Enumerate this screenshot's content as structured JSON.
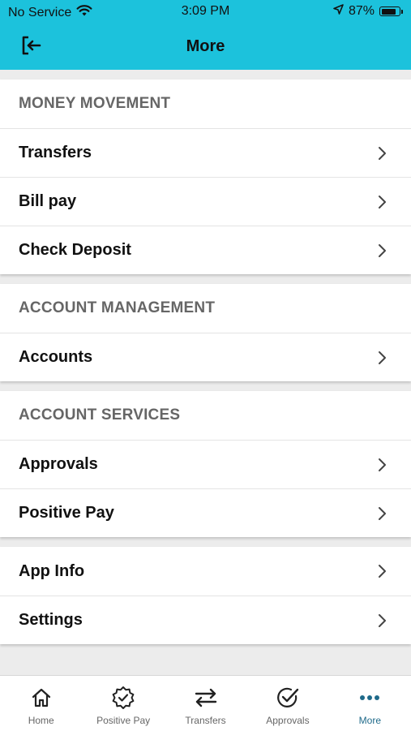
{
  "status_bar": {
    "carrier": "No Service",
    "time": "3:09 PM",
    "battery": "87%",
    "battery_level": 0.87
  },
  "header": {
    "title": "More",
    "logout_icon": "logout-icon"
  },
  "sections": [
    {
      "title": "MONEY MOVEMENT",
      "items": [
        {
          "label": "Transfers"
        },
        {
          "label": "Bill pay"
        },
        {
          "label": "Check Deposit"
        }
      ]
    },
    {
      "title": "ACCOUNT MANAGEMENT",
      "items": [
        {
          "label": "Accounts"
        }
      ]
    },
    {
      "title": "ACCOUNT SERVICES",
      "items": [
        {
          "label": "Approvals"
        },
        {
          "label": "Positive Pay"
        }
      ]
    },
    {
      "title": "",
      "items": [
        {
          "label": "App Info"
        },
        {
          "label": "Settings"
        }
      ]
    }
  ],
  "tab_bar": {
    "active": "More",
    "tabs": [
      {
        "label": "Home",
        "icon": "home-icon"
      },
      {
        "label": "Positive Pay",
        "icon": "badge-check-icon"
      },
      {
        "label": "Transfers",
        "icon": "transfer-arrows-icon"
      },
      {
        "label": "Approvals",
        "icon": "circle-check-icon"
      },
      {
        "label": "More",
        "icon": "more-dots-icon"
      }
    ]
  },
  "colors": {
    "header_bg": "#1cc2dc",
    "active_tab": "#1f6a8a",
    "section_title": "#666666"
  }
}
